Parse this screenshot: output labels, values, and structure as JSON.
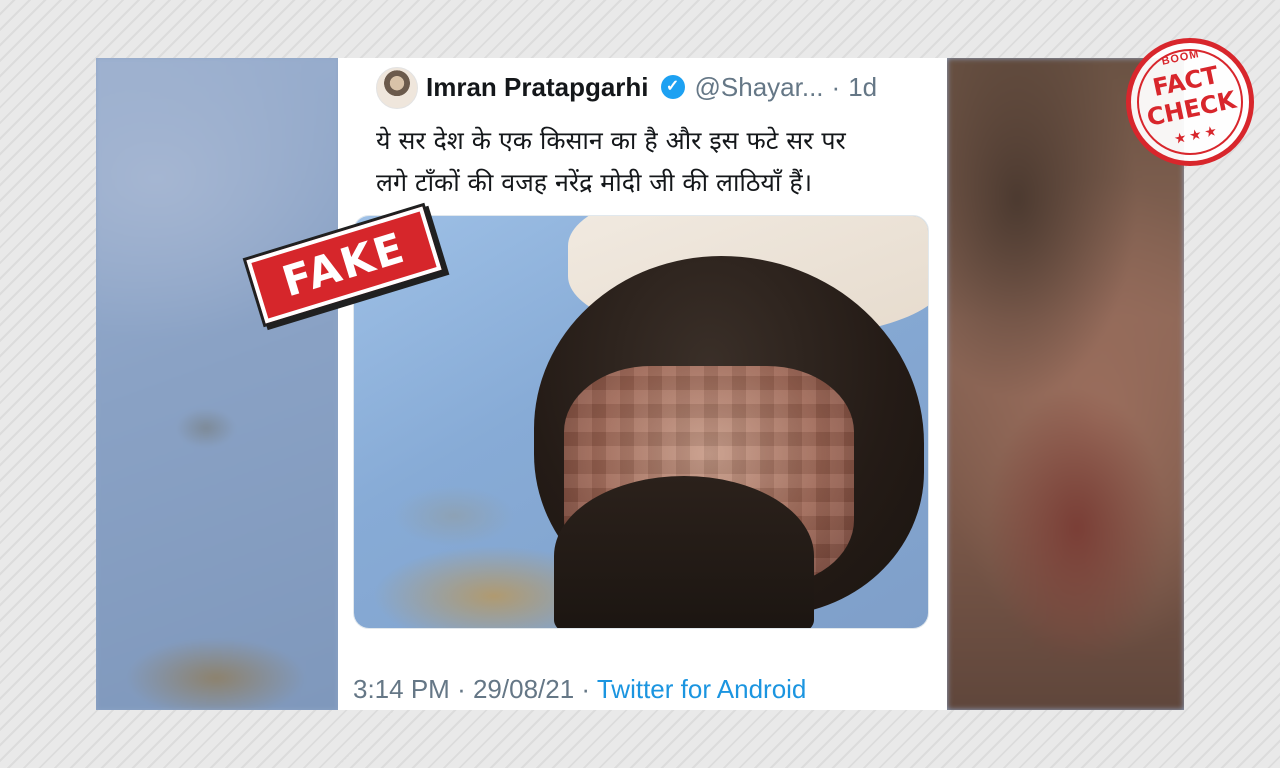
{
  "tweet": {
    "name": "Imran Pratapgarhi",
    "verified_glyph": "✓",
    "handle": "@Shayar...",
    "separator": "·",
    "age": "1d",
    "text_line1": "ये सर देश के एक किसान का है और इस फटे सर पर",
    "text_line2": "लगे टाँकों की वजह नरेंद्र मोदी जी की लाठियाँ हैं।",
    "footer_time": "3:14 PM",
    "footer_date": "29/08/21",
    "footer_source": "Twitter for Android"
  },
  "stamp": {
    "fake_label": "FAKE"
  },
  "badge": {
    "brand": "BOOM",
    "word1": "FACT",
    "word2": "CHECK",
    "stars": "★★★"
  },
  "colors": {
    "stamp_red": "#d6262b",
    "badge_red": "#d8262c",
    "twitter_blue": "#1b95e0",
    "verified_blue": "#1da1f2"
  },
  "icons": [
    "verified-badge-icon",
    "avatar",
    "fact-check-logo"
  ]
}
